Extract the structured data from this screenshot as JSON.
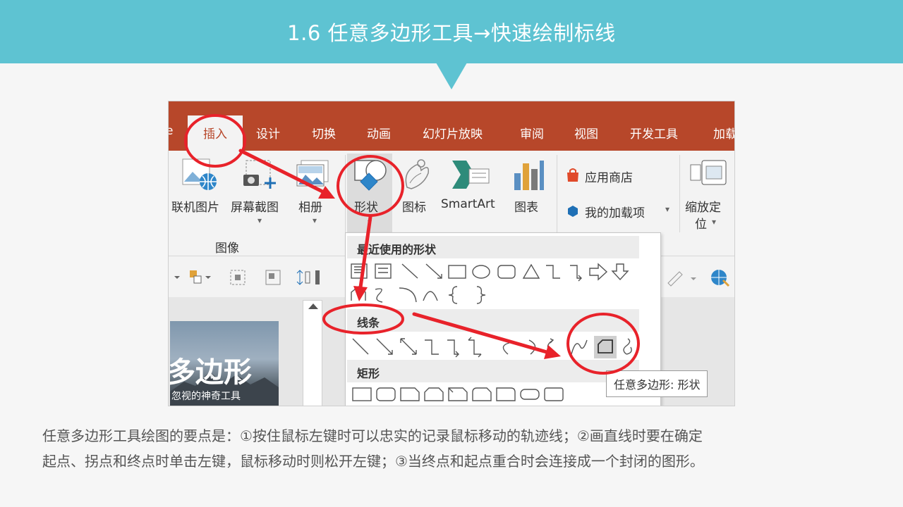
{
  "header": {
    "title": "1.6 任意多边形工具→快速绘制标线"
  },
  "ribbon": {
    "tabs": [
      "e",
      "插入",
      "设计",
      "切换",
      "动画",
      "幻灯片放映",
      "审阅",
      "视图",
      "开发工具",
      "加载"
    ],
    "buttons": {
      "online_pictures": "联机图片",
      "screenshot": "屏幕截图",
      "album": "相册",
      "shapes": "形状",
      "icons": "图标",
      "smartart": "SmartArt",
      "chart": "图表",
      "app_store": "应用商店",
      "my_addins": "我的加载项",
      "zoom_line1": "缩放定",
      "zoom_line2": "位"
    },
    "group_label": "图像"
  },
  "dropdown": {
    "recent_label": "最近使用的形状",
    "lines_label": "线条",
    "rect_label": "矩形"
  },
  "thumbnail": {
    "title": "多边形",
    "subtitle": "忽视的神奇工具"
  },
  "tooltip": {
    "text": "任意多边形: 形状"
  },
  "caption": {
    "line1": "任意多边形工具绘图的要点是：①按住鼠标左键时可以忠实的记录鼠标移动的轨迹线；②画直线时要在确定",
    "line2": "起点、拐点和终点时单击左键，鼠标移动时则松开左键；③当终点和起点重合时会连接成一个封闭的图形。"
  },
  "colors": {
    "banner": "#5ec3d2",
    "ribbon": "#b7472a",
    "annotation": "#e8222a"
  }
}
